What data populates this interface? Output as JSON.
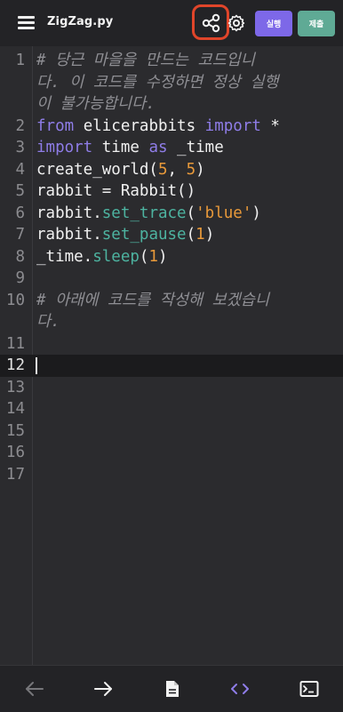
{
  "header": {
    "title": "ZigZag.py",
    "run_label": "실행",
    "submit_label": "제출",
    "icons": [
      "menu-icon",
      "share-icon",
      "gear-icon"
    ]
  },
  "editor": {
    "active_line": 12,
    "lines": [
      {
        "n": "1",
        "wrapped": [
          "# 당근 마을을 만드는 코드입니",
          "다. 이 코드를 수정하면 정상 실행",
          "이 불가능합니다."
        ]
      },
      {
        "n": "2",
        "text": "from elicerabbits import *"
      },
      {
        "n": "3",
        "text": "import time as _time"
      },
      {
        "n": "4",
        "text": "create_world(5, 5)"
      },
      {
        "n": "5",
        "text": "rabbit = Rabbit()"
      },
      {
        "n": "6",
        "text": "rabbit.set_trace('blue')"
      },
      {
        "n": "7",
        "text": "rabbit.set_pause(1)"
      },
      {
        "n": "8",
        "text": "_time.sleep(1)"
      },
      {
        "n": "9",
        "text": ""
      },
      {
        "n": "10",
        "wrapped": [
          "# 아래에 코드를 작성해 보겠습니",
          "다."
        ]
      },
      {
        "n": "11",
        "text": ""
      },
      {
        "n": "12",
        "text": ""
      },
      {
        "n": "13",
        "text": ""
      },
      {
        "n": "14",
        "text": ""
      },
      {
        "n": "15",
        "text": ""
      },
      {
        "n": "16",
        "text": ""
      },
      {
        "n": "17",
        "text": ""
      }
    ]
  },
  "bottom_bar": {
    "icons": [
      "arrow-left-icon",
      "arrow-right-icon",
      "document-icon",
      "code-icon",
      "terminal-icon"
    ]
  },
  "colors": {
    "accent": "#7d68e8",
    "submit": "#5faa95",
    "share_highlight": "#e0452a"
  }
}
